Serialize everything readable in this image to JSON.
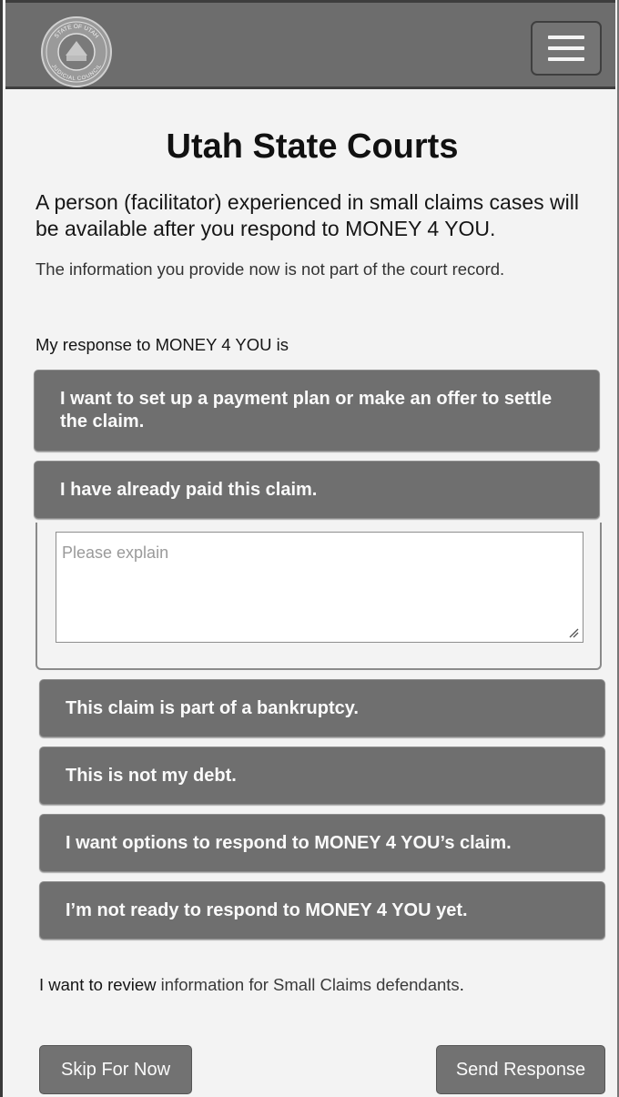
{
  "header": {
    "logo": "seal-icon",
    "seal_text_top": "STATE OF UTAH",
    "seal_text_bottom": "JUDICIAL COUNCIL",
    "menu_icon": "hamburger-menu-icon"
  },
  "main": {
    "title": "Utah State Courts",
    "intro": "A person (facilitator) experienced in small claims cases will be available after you respond to MONEY 4 YOU.",
    "note": "The information you provide now is not part of the court record.",
    "prompt": "My response to MONEY 4 YOU is",
    "options": [
      {
        "label": "I want to set up a payment plan or make an offer to settle the claim."
      },
      {
        "label": "I have already paid this claim."
      },
      {
        "label": "This claim is part of a bankruptcy."
      },
      {
        "label": "This is not my debt."
      },
      {
        "label": "I want options to respond to MONEY 4 YOU’s claim."
      },
      {
        "label": "I’m not ready to respond to MONEY 4 YOU yet."
      }
    ],
    "explain_placeholder": "Please explain",
    "review_prefix": "I want to review ",
    "review_link": "information for Small Claims defendants",
    "review_suffix": "."
  },
  "footer": {
    "skip_label": "Skip For Now",
    "send_label": "Send Response"
  },
  "colors": {
    "header_bg": "#6d6d6d",
    "option_bg": "#6f6f6f",
    "page_bg": "#f3f3f3"
  }
}
